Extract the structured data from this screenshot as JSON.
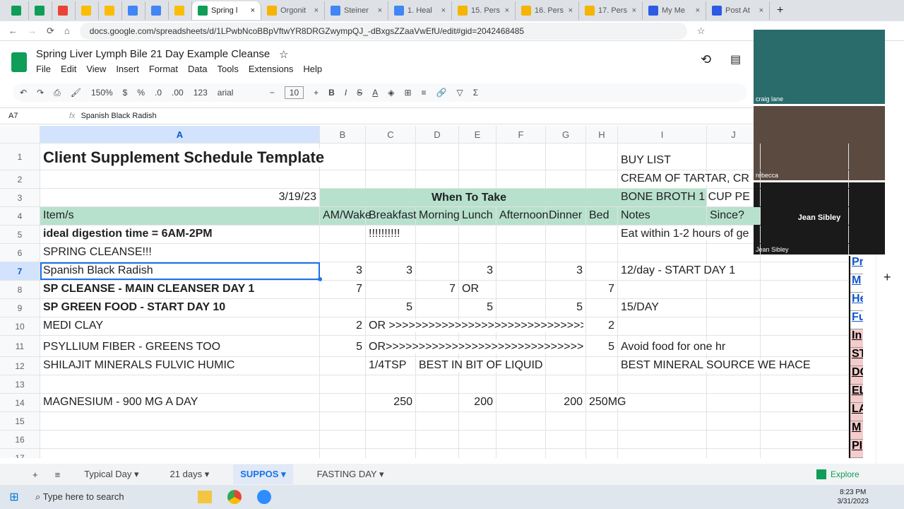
{
  "browser": {
    "tabs": [
      {
        "label": "",
        "color": "#0f9d58"
      },
      {
        "label": "",
        "color": "#0f9d58"
      },
      {
        "label": "",
        "color": "#ea4335"
      },
      {
        "label": "",
        "color": "#fbbc04"
      },
      {
        "label": "",
        "color": "#fbbc04"
      },
      {
        "label": "",
        "color": "#4285f4"
      },
      {
        "label": "",
        "color": "#4285f4"
      },
      {
        "label": "",
        "color": "#fbbc04"
      },
      {
        "label": "Spring l",
        "color": "#0f9d58",
        "active": true
      },
      {
        "label": "Orgonit",
        "color": "#f4b400"
      },
      {
        "label": "Steiner",
        "color": "#4285f4"
      },
      {
        "label": "1. Heal",
        "color": "#4285f4"
      },
      {
        "label": "15. Pers",
        "color": "#f4b400"
      },
      {
        "label": "16. Pers",
        "color": "#f4b400"
      },
      {
        "label": "17. Pers",
        "color": "#f4b400"
      },
      {
        "label": "My Me",
        "color": "#2d5be3"
      },
      {
        "label": "Post At",
        "color": "#2d5be3"
      }
    ],
    "url": "docs.google.com/spreadsheets/d/1LPwbNcoBBpVftwYR8DRGZwympQJ_-dBxgsZZaaVwEfU/edit#gid=2042468485"
  },
  "doc": {
    "title": "Spring Liver Lymph Bile  21 Day Example Cleanse",
    "menu": [
      "File",
      "Edit",
      "View",
      "Insert",
      "Format",
      "Data",
      "Tools",
      "Extensions",
      "Help"
    ]
  },
  "toolbar": {
    "zoom": "150%",
    "currency": "$",
    "percent": "%",
    "dec_less": ".0",
    "dec_more": ".00",
    "format": "123",
    "font": "arial",
    "font_size": "10"
  },
  "formula": {
    "cell_ref": "A7",
    "fx": "fx",
    "value": "Spanish Black Radish"
  },
  "columns": [
    "A",
    "B",
    "C",
    "D",
    "E",
    "F",
    "G",
    "H",
    "I",
    "J"
  ],
  "rows": [
    {
      "n": "1",
      "h": 38,
      "cells": [
        {
          "c": "A",
          "t": "Client Supplement Schedule Template",
          "b": true,
          "size": 22
        },
        {
          "c": "I",
          "t": "BUY LIST"
        }
      ]
    },
    {
      "n": "2",
      "h": 26,
      "cells": [
        {
          "c": "I",
          "t": "CREAM OF TARTAR, CR"
        }
      ]
    },
    {
      "n": "3",
      "h": 26,
      "cells": [
        {
          "c": "A",
          "t": "3/19/23",
          "align": "right"
        },
        {
          "c": "B",
          "t": "When To Take",
          "b": true,
          "green": true,
          "span": "BH"
        },
        {
          "c": "I",
          "t": "BONE BROTH 1 CUP PE",
          "green": true
        }
      ]
    },
    {
      "n": "4",
      "h": 26,
      "green": true,
      "cells": [
        {
          "c": "A",
          "t": "Item/s"
        },
        {
          "c": "B",
          "t": "AM/Wake"
        },
        {
          "c": "C",
          "t": "Breakfast"
        },
        {
          "c": "D",
          "t": "Morning"
        },
        {
          "c": "E",
          "t": "Lunch"
        },
        {
          "c": "F",
          "t": "Afternoon"
        },
        {
          "c": "G",
          "t": "Dinner"
        },
        {
          "c": "H",
          "t": "Bed"
        },
        {
          "c": "I",
          "t": "Notes"
        },
        {
          "c": "J",
          "t": "Since?"
        }
      ]
    },
    {
      "n": "5",
      "h": 26,
      "cells": [
        {
          "c": "A",
          "t": "ideal digestion time = 6AM-2PM",
          "b": true
        },
        {
          "c": "C",
          "t": "!!!!!!!!!!"
        },
        {
          "c": "I",
          "t": "Eat within 1-2 hours of ge"
        }
      ]
    },
    {
      "n": "6",
      "h": 26,
      "cells": [
        {
          "c": "A",
          "t": "SPRING CLEANSE!!!"
        }
      ]
    },
    {
      "n": "7",
      "h": 26,
      "cells": [
        {
          "c": "A",
          "t": "Spanish Black Radish",
          "sel": true
        },
        {
          "c": "B",
          "t": "3",
          "align": "right"
        },
        {
          "c": "C",
          "t": "3",
          "align": "right"
        },
        {
          "c": "E",
          "t": "3",
          "align": "right"
        },
        {
          "c": "G",
          "t": "3",
          "align": "right"
        },
        {
          "c": "I",
          "t": "12/day - START DAY 1"
        }
      ]
    },
    {
      "n": "8",
      "h": 26,
      "cells": [
        {
          "c": "A",
          "t": "SP CLEANSE - MAIN CLEANSER DAY 1",
          "b": true
        },
        {
          "c": "B",
          "t": "7",
          "align": "right"
        },
        {
          "c": "D",
          "t": "7",
          "align": "right"
        },
        {
          "c": "E",
          "t": "OR"
        },
        {
          "c": "H",
          "t": "7",
          "align": "right"
        }
      ]
    },
    {
      "n": "9",
      "h": 26,
      "cells": [
        {
          "c": "A",
          "t": "SP GREEN FOOD - START DAY 10",
          "b": true
        },
        {
          "c": "C",
          "t": "5",
          "align": "right"
        },
        {
          "c": "E",
          "t": "5",
          "align": "right"
        },
        {
          "c": "G",
          "t": "5",
          "align": "right"
        },
        {
          "c": "I",
          "t": "15/DAY"
        }
      ]
    },
    {
      "n": "10",
      "h": 26,
      "cells": [
        {
          "c": "A",
          "t": "MEDI CLAY"
        },
        {
          "c": "B",
          "t": "2",
          "align": "right"
        },
        {
          "c": "C",
          "t": "OR >>>>>>>>>>>>>>>>>>>>>>>>>>>>>>>",
          "clip": "CG"
        },
        {
          "c": "H",
          "t": "2",
          "align": "right"
        }
      ]
    },
    {
      "n": "11",
      "h": 30,
      "cells": [
        {
          "c": "A",
          "t": "PSYLLIUM FIBER - GREENS TOO"
        },
        {
          "c": "B",
          "t": "5",
          "align": "right"
        },
        {
          "c": "C",
          "t": "OR>>>>>>>>>>>>>>>>>>>>>>>>>>>>>>>",
          "clip": "CG"
        },
        {
          "c": "H",
          "t": "5",
          "align": "right"
        },
        {
          "c": "I",
          "t": "Avoid food for one hr"
        }
      ]
    },
    {
      "n": "12",
      "h": 26,
      "cells": [
        {
          "c": "A",
          "t": "SHILAJIT MINERALS FULVIC HUMIC"
        },
        {
          "c": "C",
          "t": "1/4TSP"
        },
        {
          "c": "D",
          "t": "BEST IN BIT OF LIQUID"
        },
        {
          "c": "I",
          "t": "BEST MINERAL SOURCE WE HACE"
        }
      ]
    },
    {
      "n": "13",
      "h": 26,
      "cells": []
    },
    {
      "n": "14",
      "h": 26,
      "cells": [
        {
          "c": "A",
          "t": "MAGNESIUM - 900 MG A DAY"
        },
        {
          "c": "C",
          "t": "250",
          "align": "right"
        },
        {
          "c": "E",
          "t": "200",
          "align": "right"
        },
        {
          "c": "G",
          "t": "200",
          "align": "right"
        },
        {
          "c": "H",
          "t": "250MG"
        }
      ]
    },
    {
      "n": "15",
      "h": 26,
      "cells": []
    },
    {
      "n": "16",
      "h": 26,
      "cells": []
    },
    {
      "n": "17",
      "h": 26,
      "cells": []
    }
  ],
  "right_links": [
    "Pr",
    "M",
    "He",
    "Fu",
    "In",
    "ST",
    "DO",
    "EL",
    "LA",
    "M",
    "PI"
  ],
  "sheet_tabs": [
    {
      "label": "Typical Day"
    },
    {
      "label": "21 days"
    },
    {
      "label": "SUPPOS",
      "active": true
    },
    {
      "label": "FASTING DAY"
    }
  ],
  "explore": "Explore",
  "video": [
    {
      "name": "craig lane"
    },
    {
      "name": "rebecca"
    },
    {
      "name": "Jean Sibley",
      "center": "Jean Sibley"
    }
  ],
  "taskbar": {
    "search_placeholder": "Type here to search",
    "time": "8:23 PM",
    "date": "3/31/2023"
  },
  "colors": {
    "green_header": "#b7e1cd",
    "selection": "#1a73e8",
    "sheets_green": "#0f9d58",
    "link_blue": "#1155cc",
    "pink": "#f4cccc"
  }
}
